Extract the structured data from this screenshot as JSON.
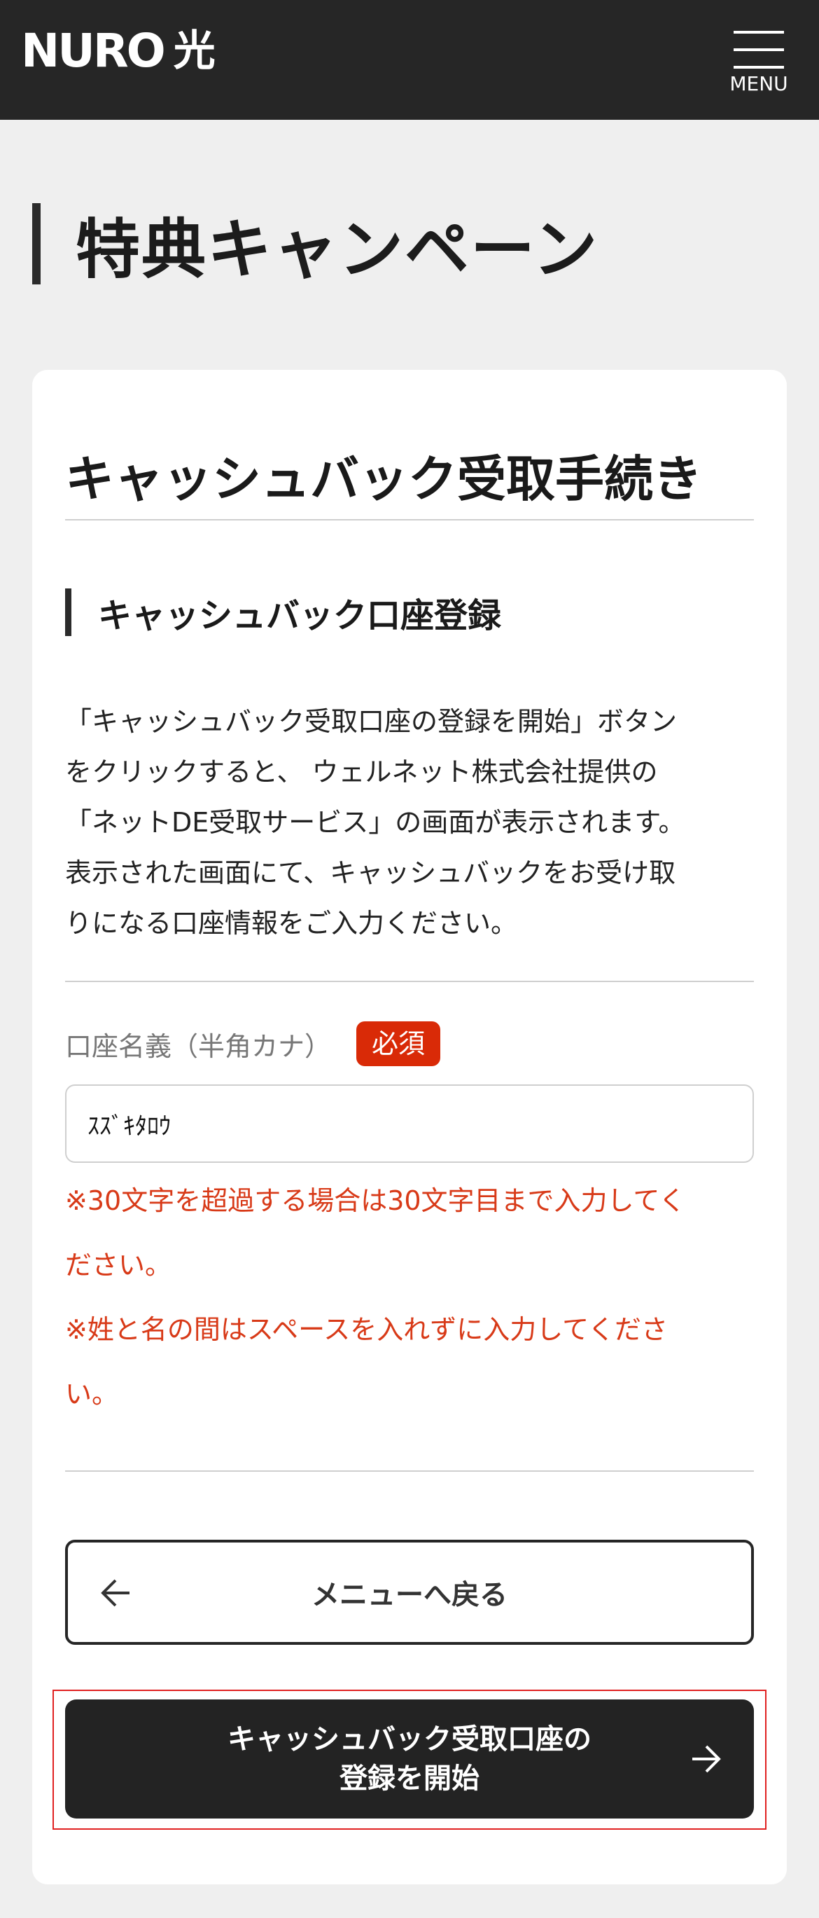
{
  "header": {
    "logo_text": "NURO",
    "logo_sub": "光",
    "menu_label": "MENU"
  },
  "page_title": "特典キャンペーン",
  "card": {
    "section_title": "キャッシュバック受取手続き",
    "sub_title": "キャッシュバック口座登録",
    "description_lines": [
      "「キャッシュバック受取口座の登録を開始」ボタン",
      "をクリックすると、 ウェルネット株式会社提供の",
      "「ネットDE受取サービス」の画面が表示されます。",
      "表示された画面にて、キャッシュバックをお受け取",
      "りになる口座情報をご入力ください。"
    ],
    "field": {
      "label": "口座名義（半角カナ）",
      "required_badge": "必須",
      "value": "ｽｽﾞｷﾀﾛｳ"
    },
    "notes": {
      "note1_lines": [
        "※30文字を超過する場合は30文字目まで入力してく",
        "ださい。"
      ],
      "note2_lines": [
        "※姓と名の間はスペースを入れずに入力してくださ",
        "い。"
      ]
    },
    "back_button": "メニューへ戻る",
    "start_button_lines": [
      "キャッシュバック受取口座の",
      "登録を開始"
    ]
  },
  "colors": {
    "header_bg": "#262626",
    "accent_red": "#d92a07",
    "note_red": "#d83a18",
    "button_dark": "#232323"
  }
}
